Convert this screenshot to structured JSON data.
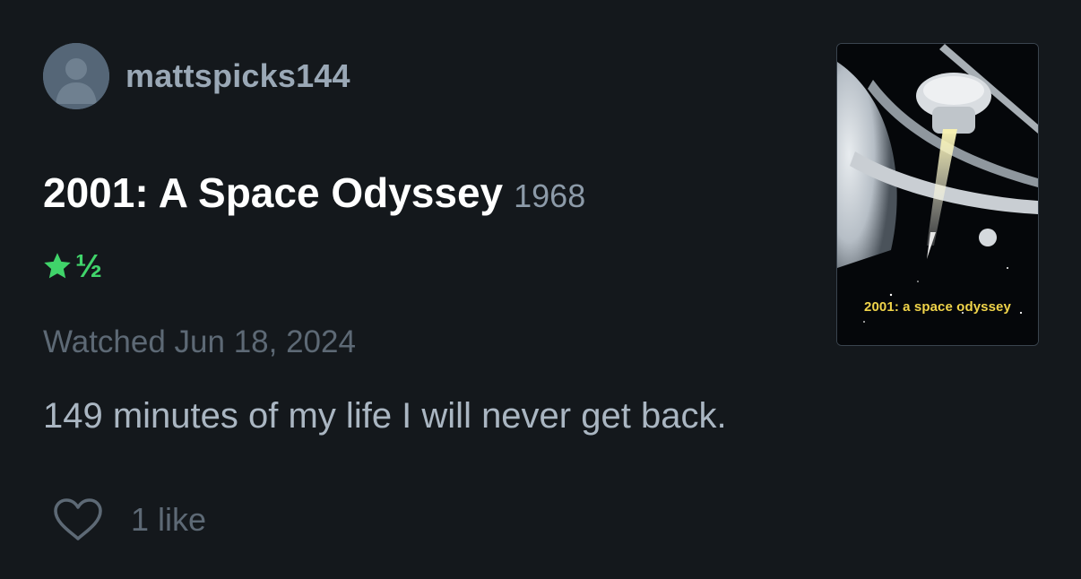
{
  "user": {
    "username": "mattspicks144",
    "avatar_icon": "person-silhouette-icon"
  },
  "film": {
    "title": "2001: A Space Odyssey",
    "year": "1968",
    "poster_caption": "2001: a space odyssey"
  },
  "rating": {
    "stars": 1.5,
    "half_symbol": "½",
    "color": "#40d46a"
  },
  "watched": "Watched Jun 18, 2024",
  "review_text": "149 minutes of my life I will never get back.",
  "likes": {
    "label": "1 like",
    "icon": "heart-outline-icon"
  },
  "colors": {
    "background": "#14181c",
    "username": "#9aa8b6",
    "muted": "#5d6975",
    "review": "#aab6c2"
  }
}
